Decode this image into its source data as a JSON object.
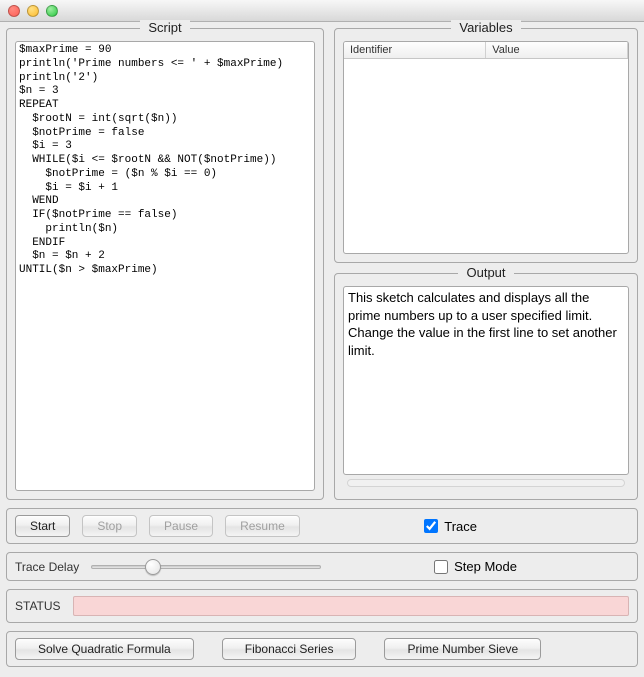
{
  "panels": {
    "script_title": "Script",
    "variables_title": "Variables",
    "output_title": "Output"
  },
  "script": {
    "code": "$maxPrime = 90\nprintln('Prime numbers <= ' + $maxPrime)\nprintln('2')\n$n = 3\nREPEAT\n  $rootN = int(sqrt($n))\n  $notPrime = false\n  $i = 3\n  WHILE($i <= $rootN && NOT($notPrime))\n    $notPrime = ($n % $i == 0)\n    $i = $i + 1\n  WEND\n  IF($notPrime == false)\n    println($n)\n  ENDIF\n  $n = $n + 2\nUNTIL($n > $maxPrime)"
  },
  "variables": {
    "col_identifier": "Identifier",
    "col_value": "Value",
    "rows": []
  },
  "output": {
    "text": "This sketch calculates and displays all the prime numbers up to a user specified limit. Change the value in the first line to set another limit."
  },
  "controls": {
    "start": "Start",
    "stop": "Stop",
    "pause": "Pause",
    "resume": "Resume",
    "trace_label": "Trace",
    "trace_checked": true
  },
  "trace": {
    "delay_label": "Trace Delay",
    "slider_value": 25,
    "step_mode_label": "Step Mode",
    "step_mode_checked": false
  },
  "status": {
    "label": "STATUS",
    "color": "#f9d6d6"
  },
  "examples": {
    "quadratic": "Solve Quadratic Formula",
    "fibonacci": "Fibonacci Series",
    "sieve": "Prime Number Sieve"
  }
}
